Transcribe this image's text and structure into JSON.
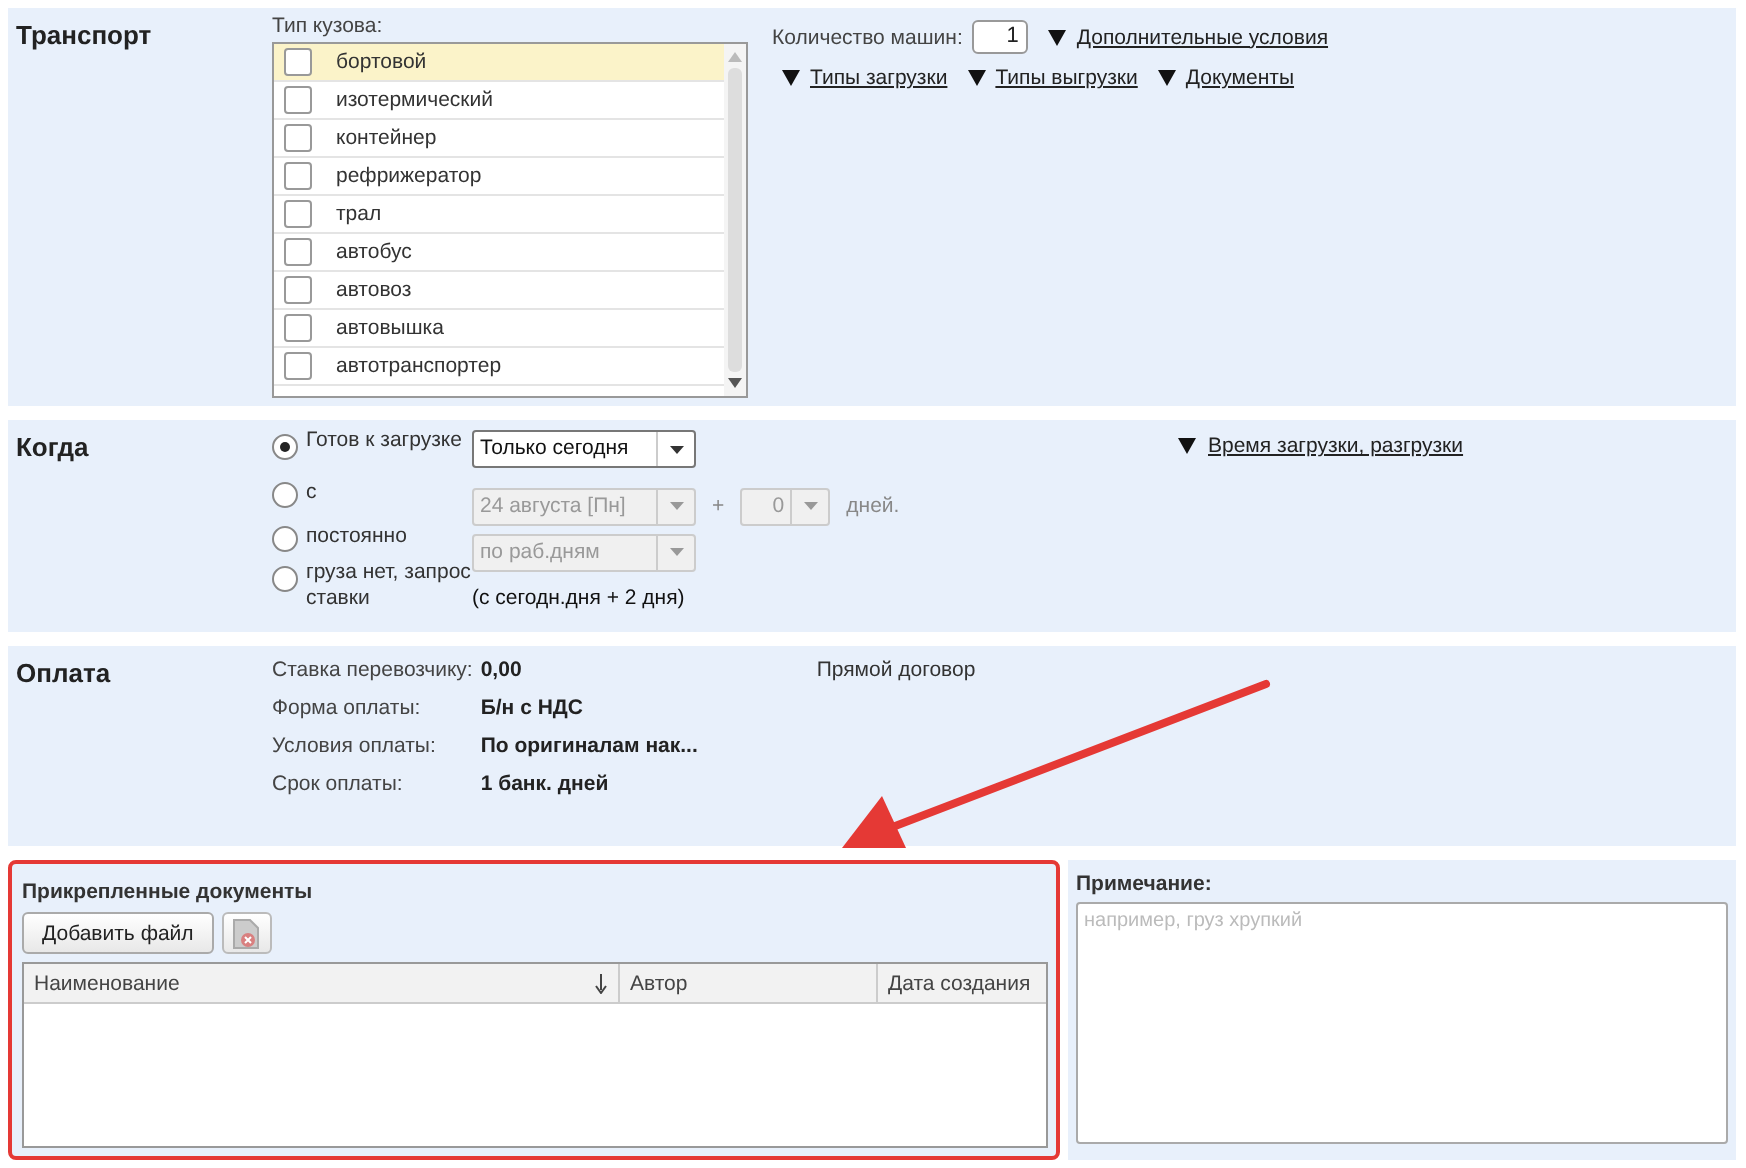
{
  "transport": {
    "title": "Транспорт",
    "body_type_label": "Тип кузова:",
    "body_types": [
      {
        "label": "бортовой",
        "checked": false,
        "selected": true
      },
      {
        "label": "изотермический",
        "checked": false,
        "selected": false
      },
      {
        "label": "контейнер",
        "checked": false,
        "selected": false
      },
      {
        "label": "рефрижератор",
        "checked": false,
        "selected": false
      },
      {
        "label": "трал",
        "checked": false,
        "selected": false
      },
      {
        "label": "автобус",
        "checked": false,
        "selected": false
      },
      {
        "label": "автовоз",
        "checked": false,
        "selected": false
      },
      {
        "label": "автовышка",
        "checked": false,
        "selected": false
      },
      {
        "label": "автотранспортер",
        "checked": false,
        "selected": false
      }
    ],
    "car_count_label": "Количество машин:",
    "car_count": "1",
    "extra_link": "Дополнительные условия",
    "links": [
      "Типы загрузки",
      "Типы выгрузки",
      "Документы"
    ]
  },
  "when": {
    "title": "Когда",
    "options": [
      {
        "label": "Готов к загрузке",
        "selected": true
      },
      {
        "label": "с",
        "selected": false
      },
      {
        "label": "постоянно",
        "selected": false
      },
      {
        "label": "груза нет, запрос ставки",
        "selected": false
      }
    ],
    "ready_select": {
      "value": "Только сегодня",
      "disabled": false
    },
    "date_select": {
      "value": "24 августа [Пн]",
      "disabled": true
    },
    "plus": "+",
    "days_select": {
      "value": "0",
      "disabled": true
    },
    "days_label": "дней.",
    "schedule_select": {
      "value": "по раб.дням",
      "disabled": true
    },
    "hint": "(с сегодн.дня + 2 дня)",
    "time_link": "Время загрузки, разгрузки"
  },
  "payment": {
    "title": "Оплата",
    "rows": [
      {
        "label": "Ставка перевозчику:",
        "value": "0,00"
      },
      {
        "label": "Форма оплаты:",
        "value": "Б/н с НДС"
      },
      {
        "label": "Условия оплаты:",
        "value": "По оригиналам нак..."
      },
      {
        "label": "Срок оплаты:",
        "value": "1 банк. дней"
      }
    ],
    "contract": "Прямой договор"
  },
  "documents": {
    "title": "Прикрепленные документы",
    "highlighted": true,
    "add_button": "Добавить файл",
    "columns": [
      {
        "label": "Наименование",
        "sorted": true
      },
      {
        "label": "Автор",
        "sorted": false
      },
      {
        "label": "Дата создания",
        "sorted": false
      }
    ]
  },
  "note": {
    "label": "Примечание:",
    "placeholder": "например, груз хрупкий"
  }
}
